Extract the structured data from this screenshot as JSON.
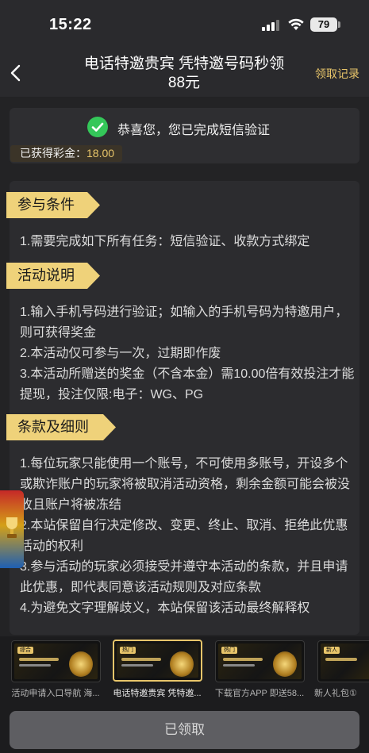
{
  "status_bar": {
    "time": "15:22",
    "battery": "79"
  },
  "nav": {
    "title": "电话特邀贵宾 凭特邀号码秒领88元",
    "right_link": "领取记录"
  },
  "verify": {
    "message": "恭喜您，您已完成短信验证",
    "bonus_label": "已获得彩金：",
    "bonus_value": "18.00"
  },
  "sections": [
    {
      "title": "参与条件",
      "lines": [
        "1.需要完成如下所有任务：短信验证、收款方式绑定"
      ]
    },
    {
      "title": "活动说明",
      "lines": [
        "1.输入手机号码进行验证；如输入的手机号码为特邀用户，则可获得奖金",
        "2.本活动仅可参与一次，过期即作废",
        "3.本活动所赠送的奖金（不含本金）需10.00倍有效投注才能提现，投注仅限:电子：WG、PG"
      ]
    },
    {
      "title": "条款及细则",
      "lines": [
        "1.每位玩家只能使用一个账号，不可使用多账号，开设多个或欺诈账户的玩家将被取消活动资格，剩余金额可能会被没收且账户将被冻结",
        "2.本站保留自行决定修改、变更、终止、取消、拒绝此优惠活动的权利",
        "3.参与活动的玩家必须接受并遵守本活动的条款，并且申请此优惠，即代表同意该活动规则及对应条款",
        "4.为避免文字理解歧义，本站保留该活动最终解释权"
      ]
    }
  ],
  "banners": [
    {
      "caption": "活动申请入口导航 海...",
      "chip": "综合"
    },
    {
      "caption": "电话特邀贵宾 凭特邀...",
      "chip": "热门"
    },
    {
      "caption": "下载官方APP 即送58...",
      "chip": "热门"
    },
    {
      "caption": "新人礼包①",
      "chip": "新人"
    }
  ],
  "bottom_button": "已领取",
  "colors": {
    "accent": "#e8c56a",
    "tag": "#efd27a",
    "check": "#34c759"
  }
}
